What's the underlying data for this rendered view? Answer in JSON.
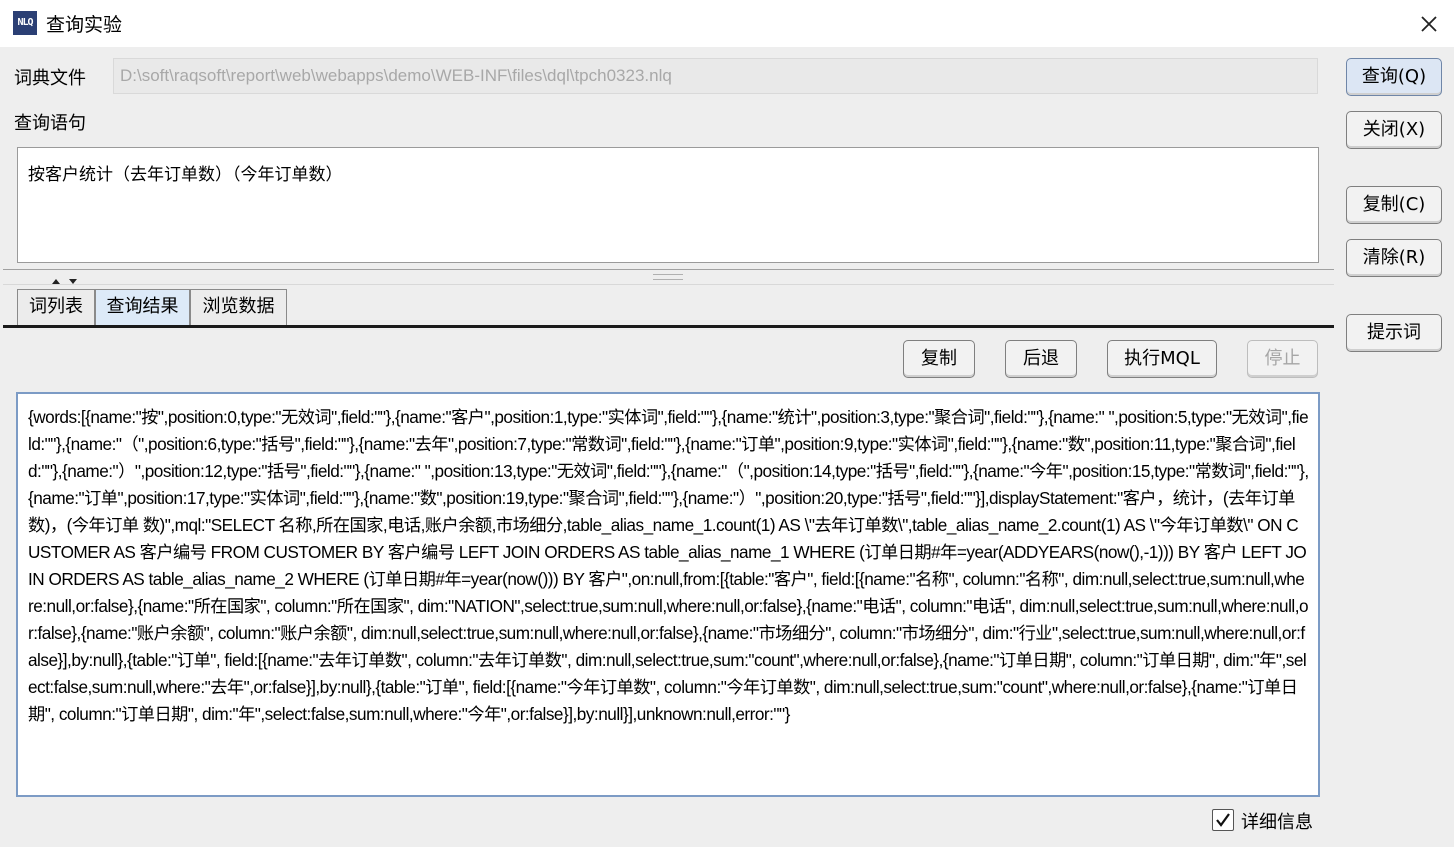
{
  "window": {
    "icon_text": "NLQ",
    "title": "查询实验"
  },
  "form": {
    "dict_label": "词典文件",
    "dict_path": "D:\\soft\\raqsoft\\report\\web\\webapps\\demo\\WEB-INF\\files\\dql\\tpch0323.nlq",
    "query_label": "查询语句",
    "query_text": "按客户统计（去年订单数）（今年订单数）"
  },
  "side_buttons": {
    "query": "查询(Q)",
    "close": "关闭(X)",
    "copy": "复制(C)",
    "clear": "清除(R)",
    "hint": "提示词"
  },
  "tabs": [
    {
      "label": "词列表",
      "active": false
    },
    {
      "label": "查询结果",
      "active": true
    },
    {
      "label": "浏览数据",
      "active": false
    }
  ],
  "result_toolbar": {
    "copy": "复制",
    "back": "后退",
    "exec_mql": "执行MQL",
    "stop": "停止"
  },
  "result_text": "{words:[{name:\"按\",position:0,type:\"无效词\",field:\"\"},{name:\"客户\",position:1,type:\"实体词\",field:\"\"},{name:\"统计\",position:3,type:\"聚合词\",field:\"\"},{name:\" \",position:5,type:\"无效词\",field:\"\"},{name:\"（\",position:6,type:\"括号\",field:\"\"},{name:\"去年\",position:7,type:\"常数词\",field:\"\"},{name:\"订单\",position:9,type:\"实体词\",field:\"\"},{name:\"数\",position:11,type:\"聚合词\",field:\"\"},{name:\"）\",position:12,type:\"括号\",field:\"\"},{name:\" \",position:13,type:\"无效词\",field:\"\"},{name:\"（\",position:14,type:\"括号\",field:\"\"},{name:\"今年\",position:15,type:\"常数词\",field:\"\"},{name:\"订单\",position:17,type:\"实体词\",field:\"\"},{name:\"数\",position:19,type:\"聚合词\",field:\"\"},{name:\"）\",position:20,type:\"括号\",field:\"\"}],displayStatement:\"客户，统计，(去年订单 数)，(今年订单 数)\",mql:\"SELECT 名称,所在国家,电话,账户余额,市场细分,table_alias_name_1.count(1) AS \\\"去年订单数\\\",table_alias_name_2.count(1) AS \\\"今年订单数\\\" ON CUSTOMER AS 客户编号 FROM CUSTOMER BY 客户编号 LEFT JOIN ORDERS AS table_alias_name_1 WHERE (订单日期#年=year(ADDYEARS(now(),-1))) BY 客户 LEFT JOIN ORDERS AS table_alias_name_2 WHERE (订单日期#年=year(now())) BY 客户\",on:null,from:[{table:\"客户\", field:[{name:\"名称\", column:\"名称\", dim:null,select:true,sum:null,where:null,or:false},{name:\"所在国家\", column:\"所在国家\", dim:\"NATION\",select:true,sum:null,where:null,or:false},{name:\"电话\", column:\"电话\", dim:null,select:true,sum:null,where:null,or:false},{name:\"账户余额\", column:\"账户余额\", dim:null,select:true,sum:null,where:null,or:false},{name:\"市场细分\", column:\"市场细分\", dim:\"行业\",select:true,sum:null,where:null,or:false}],by:null},{table:\"订单\", field:[{name:\"去年订单数\", column:\"去年订单数\", dim:null,select:true,sum:\"count\",where:null,or:false},{name:\"订单日期\", column:\"订单日期\", dim:\"年\",select:false,sum:null,where:\"去年\",or:false}],by:null},{table:\"订单\", field:[{name:\"今年订单数\", column:\"今年订单数\", dim:null,select:true,sum:\"count\",where:null,or:false},{name:\"订单日期\", column:\"订单日期\", dim:\"年\",select:false,sum:null,where:\"今年\",or:false}],by:null}],unknown:null,error:\"\"}",
  "detail": {
    "label": "详细信息",
    "checked": true
  }
}
